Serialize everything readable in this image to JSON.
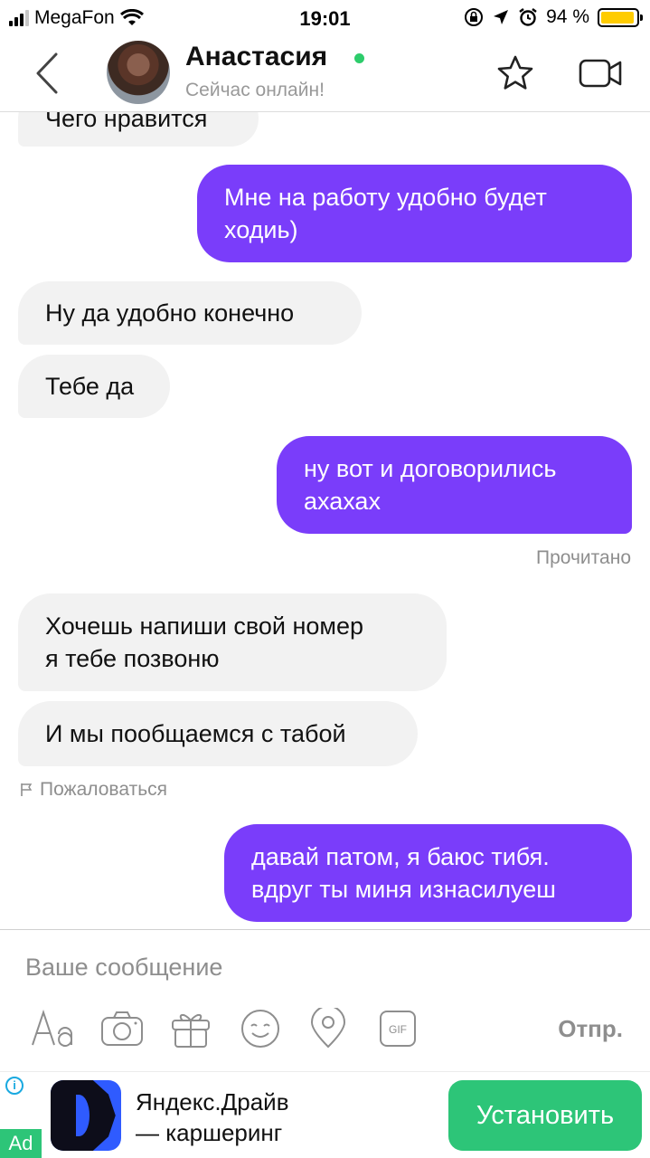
{
  "status_bar": {
    "carrier": "MegaFon",
    "time": "19:01",
    "battery_percent": "94 %",
    "battery_level": 0.94,
    "icons": [
      "signal-icon",
      "wifi-icon",
      "rotation-lock-icon",
      "location-icon",
      "alarm-icon",
      "battery-icon"
    ]
  },
  "header": {
    "name": "Анастасия",
    "status": "Сейчас онлайн!",
    "online_color": "#2dcc6b",
    "icons": [
      "back-icon",
      "star-icon",
      "video-call-icon"
    ]
  },
  "messages": [
    {
      "direction": "in",
      "lines": [
        "Чего нравится"
      ]
    },
    {
      "direction": "out",
      "lines": [
        "Мне на работу удобно будет",
        "ходиь)"
      ]
    },
    {
      "direction": "in",
      "lines": [
        "Ну да удобно конечно"
      ]
    },
    {
      "direction": "in",
      "lines": [
        "Тебе да"
      ]
    },
    {
      "direction": "out",
      "lines": [
        "ну вот и договорились",
        "ахахах"
      ]
    },
    {
      "direction": "in",
      "lines": [
        "Хочешь напиши свой номер",
        "я тебе позвоню"
      ]
    },
    {
      "direction": "in",
      "lines": [
        "И мы пообщаемся с табой"
      ]
    },
    {
      "direction": "out",
      "lines": [
        "давай патом, я баюс тибя.",
        "вдруг ты миня изнасилуеш"
      ]
    }
  ],
  "read_status": "Прочитано",
  "complain_label": "Пожаловаться",
  "composer": {
    "placeholder": "Ваше сообщение",
    "send_label": "Отпр.",
    "tools": [
      "text-format-icon",
      "camera-icon",
      "gift-icon",
      "emoji-icon",
      "location-pin-icon",
      "gif-icon"
    ],
    "gif_text": "GIF"
  },
  "ad": {
    "badge": "Ad",
    "info": "i",
    "title_line1": "Яндекс.Драйв",
    "title_line2": "— каршеринг",
    "button_label": "Установить",
    "button_color": "#2dc578"
  },
  "colors": {
    "outgoing_bubble": "#7a3dfa",
    "incoming_bubble": "#f2f2f2"
  }
}
